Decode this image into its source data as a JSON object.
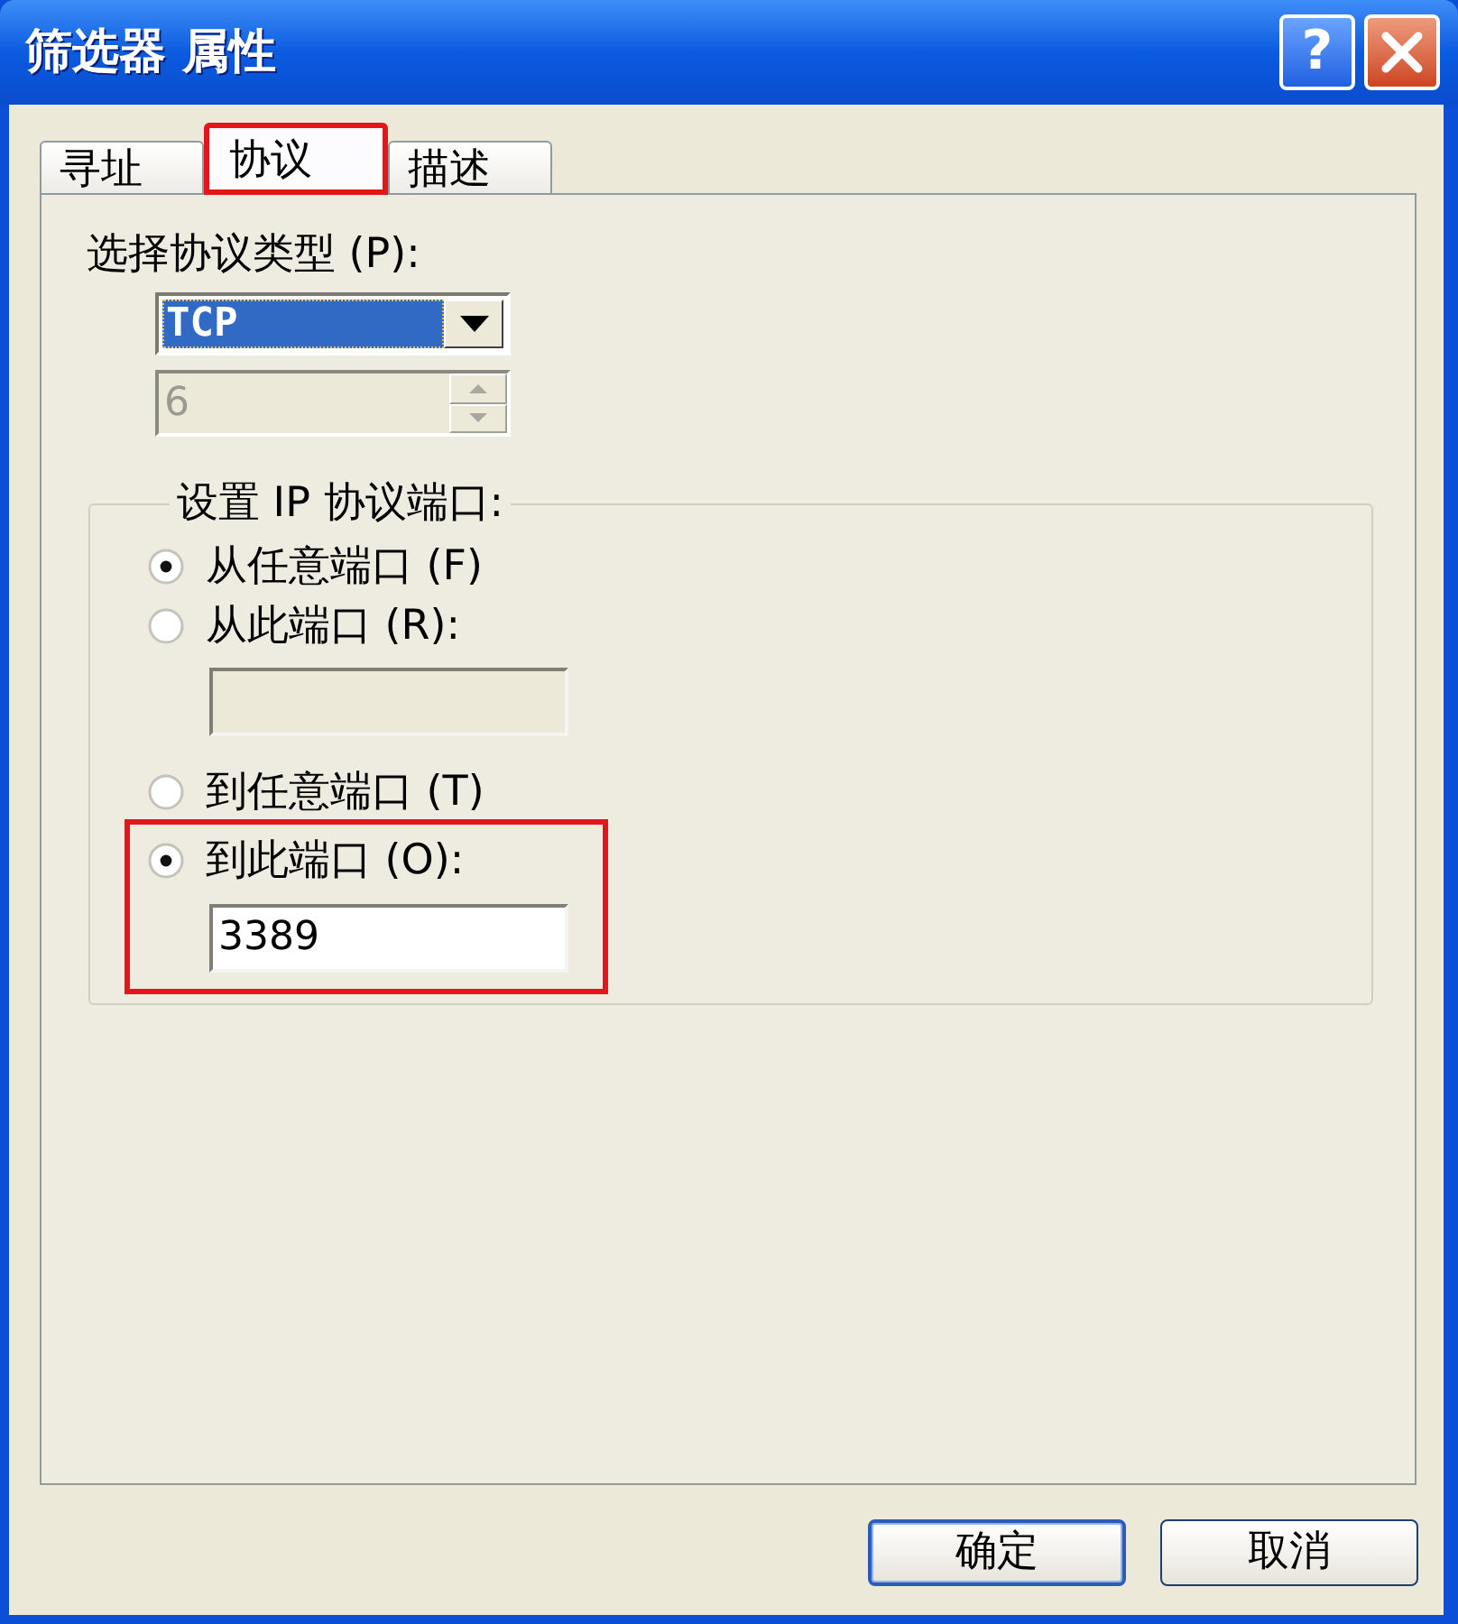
{
  "window": {
    "title": "筛选器 属性",
    "title_buttons": [
      {
        "kind": "help",
        "label": "?"
      },
      {
        "kind": "close"
      }
    ]
  },
  "tabs": [
    {
      "label": "寻址",
      "selected": false,
      "highlighted": false
    },
    {
      "label": "协议",
      "selected": true,
      "highlighted": true
    },
    {
      "label": "描述",
      "selected": false,
      "highlighted": false
    }
  ],
  "protocol": {
    "label": "选择协议类型 (P):",
    "dropdown": {
      "value": "TCP",
      "focused": true
    },
    "number_field": {
      "value": "6",
      "disabled": true
    }
  },
  "ports": {
    "title": "设置 IP 协议端口:",
    "groups": [
      {
        "options": [
          {
            "label": "从任意端口 (F)",
            "selected": true,
            "highlighted": false
          },
          {
            "label": "从此端口 (R):",
            "selected": false,
            "highlighted": false
          }
        ],
        "field": {
          "disabled": true
        }
      },
      {
        "options": [
          {
            "label": "到任意端口 (T)",
            "selected": false,
            "highlighted": false
          },
          {
            "label": "到此端口 (O):",
            "selected": true,
            "highlighted": true
          }
        ],
        "field": {
          "value": "3389",
          "disabled": false
        }
      }
    ]
  },
  "buttons": [
    {
      "label": "确定",
      "default": true
    },
    {
      "label": "取消",
      "default": false
    }
  ]
}
